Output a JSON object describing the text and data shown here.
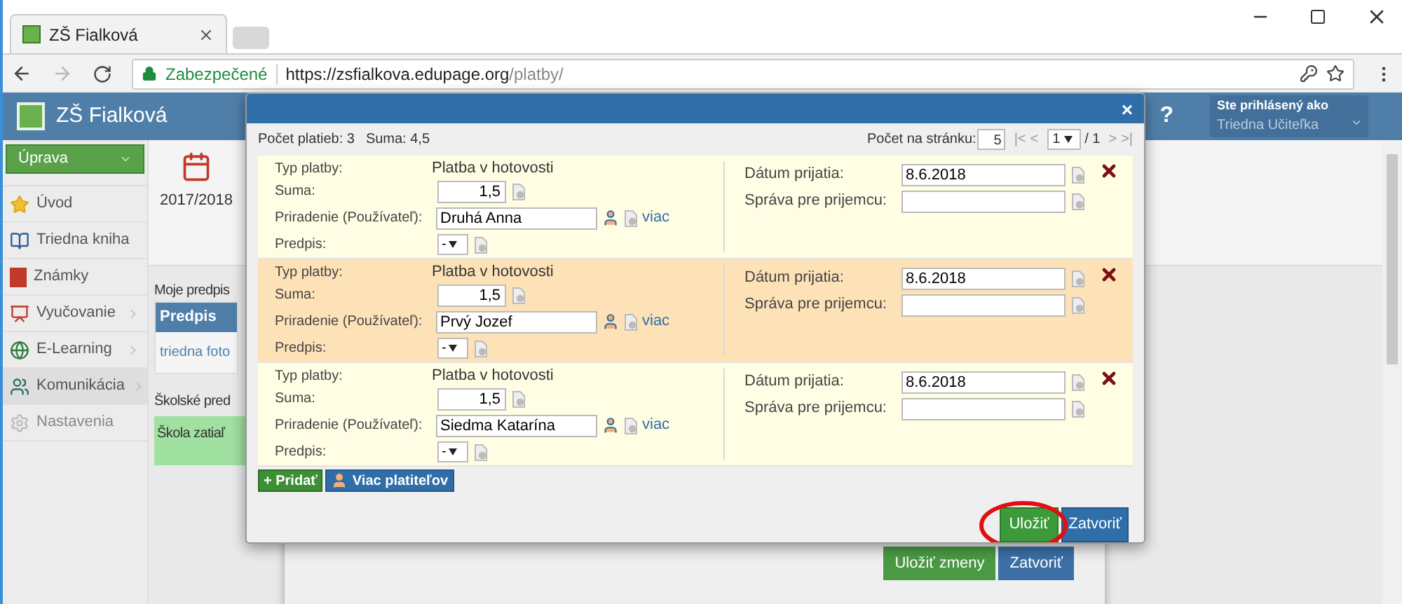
{
  "browser": {
    "tab_title": "ZŠ Fialková",
    "security": "Zabezpečené",
    "url_host": "https://zsfialkova.edupage.org",
    "url_path": "/platby/"
  },
  "header": {
    "school": "ZŠ Fialková",
    "help": "?",
    "user_caption": "Ste prihlásený ako",
    "user_name": "Triedna Učiteľka"
  },
  "sidebar": {
    "action": "Úprava",
    "items": [
      {
        "kind": "star",
        "label": "Úvod",
        "has_submenu": false,
        "selected": false
      },
      {
        "kind": "book",
        "label": "Triedna kniha",
        "has_submenu": false,
        "selected": false
      },
      {
        "kind": "grades",
        "label": "Známky",
        "has_submenu": false,
        "selected": false
      },
      {
        "kind": "teaching",
        "label": "Vyučovanie",
        "has_submenu": true,
        "selected": false
      },
      {
        "kind": "elearning",
        "label": "E-Learning",
        "has_submenu": true,
        "selected": false
      },
      {
        "kind": "chat",
        "label": "Komunikácia",
        "has_submenu": true,
        "selected": true
      },
      {
        "kind": "settings",
        "label": "Nastavenia",
        "has_submenu": false,
        "selected": false
      }
    ]
  },
  "background": {
    "year": "2017/2018",
    "section_1": "Moje predpis",
    "table_header": "Predpis",
    "table_cell": "triedna foto",
    "section_2": "Školské pred",
    "notice": "Škola zatiaľ",
    "buttons": [
      "Uložiť zmeny",
      "Zatvoriť"
    ]
  },
  "dialog": {
    "close": "×",
    "count": "Počet platieb: 3",
    "sum": "Suma: 4,5",
    "per_page_label": "Počet na stránku:",
    "per_page": "5",
    "first": "|<",
    "prev": "<",
    "page": "1",
    "page_total": "/ 1",
    "next": ">",
    "last": ">|",
    "payments": [
      {
        "selected": false,
        "type_label": "Typ platby:",
        "type": "Platba v hotovosti",
        "sum_label": "Suma:",
        "sum": "1,5",
        "payer_label": "Priradenie (Používateľ):",
        "payer": "Druhá Anna",
        "more": "viac",
        "rule_label": "Predpis:",
        "rule": "-",
        "date_label": "Dátum prijatia:",
        "date": "8.6.2018",
        "message_label": "Správa pre prijemcu:"
      },
      {
        "selected": true,
        "type_label": "Typ platby:",
        "type": "Platba v hotovosti",
        "sum_label": "Suma:",
        "sum": "1,5",
        "payer_label": "Priradenie (Používateľ):",
        "payer": "Prvý Jozef",
        "more": "viac",
        "rule_label": "Predpis:",
        "rule": "-",
        "date_label": "Dátum prijatia:",
        "date": "8.6.2018",
        "message_label": "Správa pre prijemcu:"
      },
      {
        "selected": false,
        "type_label": "Typ platby:",
        "type": "Platba v hotovosti",
        "sum_label": "Suma:",
        "sum": "1,5",
        "payer_label": "Priradenie (Používateľ):",
        "payer": "Siedma Katarína",
        "more": "viac",
        "rule_label": "Predpis:",
        "rule": "-",
        "date_label": "Dátum prijatia:",
        "date": "8.6.2018",
        "message_label": "Správa pre prijemcu:"
      }
    ],
    "add": "+ Pridať",
    "more_payers": "Viac platiteľov",
    "save": "Uložiť",
    "cancel": "Zatvoriť",
    "save_circled": true
  }
}
